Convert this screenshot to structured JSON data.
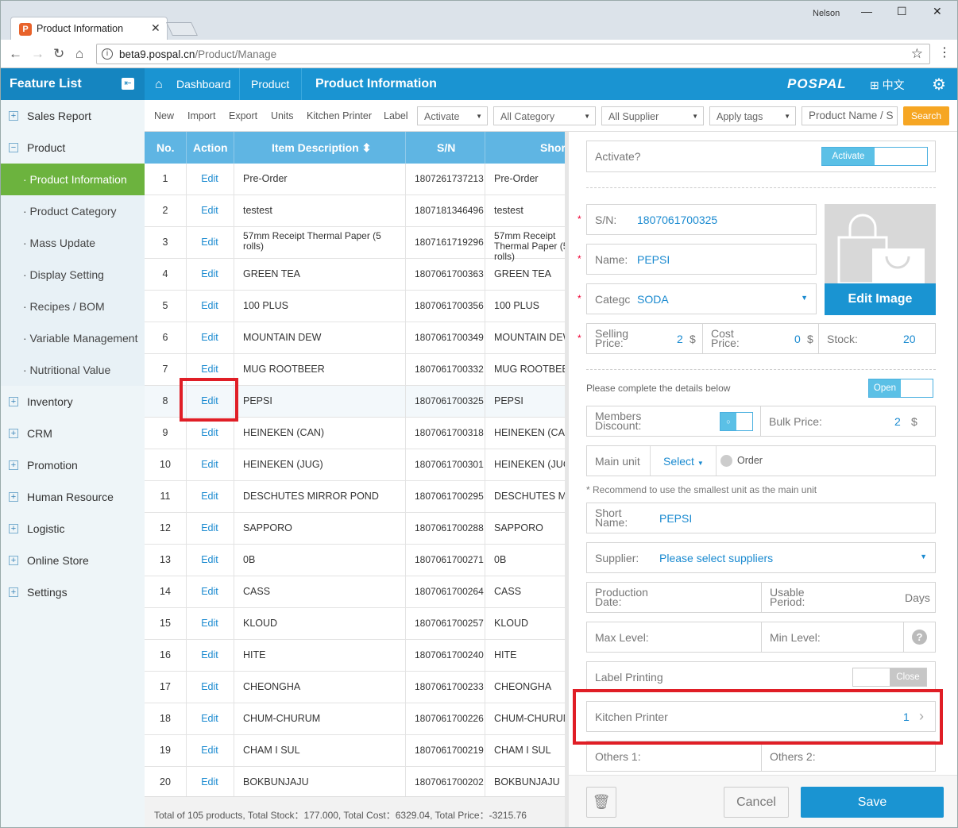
{
  "browser": {
    "tab_title": "Product Information",
    "user": "Nelson",
    "url_host": "beta9.pospal.cn",
    "url_path": "/Product/Manage"
  },
  "topbar": {
    "feature_list": "Feature List",
    "dashboard": "Dashboard",
    "product": "Product",
    "current": "Product Information",
    "logo": "POSPAL",
    "lang": "中文"
  },
  "sidebar": {
    "items": [
      {
        "label": "Sales Report",
        "sign": "+"
      },
      {
        "label": "Product",
        "sign": "−"
      },
      {
        "label": "· Product Information",
        "sub": true,
        "active": true
      },
      {
        "label": "· Product Category",
        "sub": true
      },
      {
        "label": "· Mass Update",
        "sub": true
      },
      {
        "label": "· Display Setting",
        "sub": true
      },
      {
        "label": "· Recipes / BOM",
        "sub": true
      },
      {
        "label": "· Variable Management",
        "sub": true
      },
      {
        "label": "· Nutritional Value",
        "sub": true
      },
      {
        "label": "Inventory",
        "sign": "+"
      },
      {
        "label": "CRM",
        "sign": "+"
      },
      {
        "label": "Promotion",
        "sign": "+"
      },
      {
        "label": "Human Resource",
        "sign": "+"
      },
      {
        "label": "Logistic",
        "sign": "+"
      },
      {
        "label": "Online Store",
        "sign": "+"
      },
      {
        "label": "Settings",
        "sign": "+"
      }
    ]
  },
  "toolbar": {
    "new": "New",
    "import": "Import",
    "export": "Export",
    "units": "Units",
    "kitchen": "Kitchen Printer",
    "label": "Label",
    "activate": "Activate",
    "category": "All Category",
    "supplier": "All Supplier",
    "tags": "Apply tags",
    "search_placeholder": "Product Name / S",
    "search": "Search"
  },
  "grid": {
    "headers": {
      "no": "No.",
      "action": "Action",
      "desc": "Item Description ⬍",
      "sn": "S/N",
      "short": "Shor"
    },
    "edit": "Edit",
    "rows": [
      {
        "no": "1",
        "desc": "Pre-Order",
        "sn": "1807261737213",
        "short": "Pre-Order"
      },
      {
        "no": "2",
        "desc": "testest",
        "sn": "1807181346496",
        "short": "testest"
      },
      {
        "no": "3",
        "desc": "57mm Receipt Thermal Paper (5 rolls)",
        "sn": "1807161719296",
        "short": "57mm Receipt Thermal Paper (5 rolls)"
      },
      {
        "no": "4",
        "desc": "GREEN TEA",
        "sn": "1807061700363",
        "short": "GREEN TEA"
      },
      {
        "no": "5",
        "desc": "100 PLUS",
        "sn": "1807061700356",
        "short": "100 PLUS"
      },
      {
        "no": "6",
        "desc": "MOUNTAIN DEW",
        "sn": "1807061700349",
        "short": "MOUNTAIN DEW"
      },
      {
        "no": "7",
        "desc": "MUG ROOTBEER",
        "sn": "1807061700332",
        "short": "MUG ROOTBEER"
      },
      {
        "no": "8",
        "desc": "PEPSI",
        "sn": "1807061700325",
        "short": "PEPSI"
      },
      {
        "no": "9",
        "desc": "HEINEKEN (CAN)",
        "sn": "1807061700318",
        "short": "HEINEKEN (CAN)"
      },
      {
        "no": "10",
        "desc": "HEINEKEN (JUG)",
        "sn": "1807061700301",
        "short": "HEINEKEN (JUG)"
      },
      {
        "no": "11",
        "desc": "DESCHUTES MIRROR POND",
        "sn": "1807061700295",
        "short": "DESCHUTES MIRROR POND"
      },
      {
        "no": "12",
        "desc": "SAPPORO",
        "sn": "1807061700288",
        "short": "SAPPORO"
      },
      {
        "no": "13",
        "desc": "0B",
        "sn": "1807061700271",
        "short": "0B"
      },
      {
        "no": "14",
        "desc": "CASS",
        "sn": "1807061700264",
        "short": "CASS"
      },
      {
        "no": "15",
        "desc": "KLOUD",
        "sn": "1807061700257",
        "short": "KLOUD"
      },
      {
        "no": "16",
        "desc": "HITE",
        "sn": "1807061700240",
        "short": "HITE"
      },
      {
        "no": "17",
        "desc": "CHEONGHA",
        "sn": "1807061700233",
        "short": "CHEONGHA"
      },
      {
        "no": "18",
        "desc": "CHUM-CHURUM",
        "sn": "1807061700226",
        "short": "CHUM-CHURUM"
      },
      {
        "no": "19",
        "desc": "CHAM I SUL",
        "sn": "1807061700219",
        "short": "CHAM I SUL"
      },
      {
        "no": "20",
        "desc": "BOKBUNJAJU",
        "sn": "1807061700202",
        "short": "BOKBUNJAJU"
      }
    ],
    "footer": "Total of 105 products, Total Stock：177.000, Total Cost：6329.04, Total Price：-3215.76"
  },
  "panel": {
    "activate_label": "Activate?",
    "activate_toggle": "Activate",
    "sn_label": "S/N:",
    "sn": "1807061700325",
    "name_label": "Name:",
    "name": "PEPSI",
    "cat_label": "Categc",
    "category": "SODA",
    "edit_image": "Edit Image",
    "sell_label": "Selling Price:",
    "sell": "2",
    "cost_label": "Cost Price:",
    "cost": "0",
    "currency": "$",
    "stock_label": "Stock:",
    "stock": "20",
    "details": "Please complete the details below",
    "open": "Open",
    "members_label": "Members Discount:",
    "member_toggle": "○",
    "bulk_label": "Bulk Price:",
    "bulk": "2",
    "main_unit_label": "Main unit",
    "select": "Select",
    "order": "Order",
    "recommend": "* Recommend to use the smallest unit as the main unit",
    "short_label": "Short Name:",
    "short": "PEPSI",
    "supplier_label": "Supplier:",
    "supplier": "Please select suppliers",
    "prod_label": "Production Date:",
    "usable_label": "Usable Period:",
    "days": "Days",
    "max_label": "Max Level:",
    "min_label": "Min Level:",
    "label_printing": "Label Printing",
    "close": "Close",
    "kitchen_label": "Kitchen Printer",
    "kitchen_val": "1",
    "others1": "Others 1:",
    "others2": "Others 2:",
    "cancel": "Cancel",
    "save": "Save"
  }
}
